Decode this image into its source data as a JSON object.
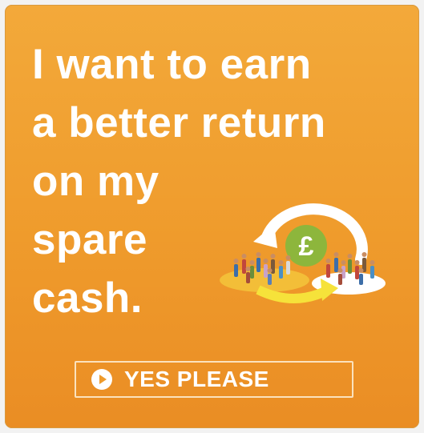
{
  "ad": {
    "headline_lines": [
      "I want to earn",
      "a better return",
      "on my",
      "spare",
      "cash."
    ],
    "currency_symbol": "£",
    "cta_label": "YES PLEASE",
    "cta_icon": "play-icon",
    "illustration_icon": "money-cycle-people-icon",
    "colors": {
      "background": "#ef9b2c",
      "text": "#ffffff",
      "coin": "#8db63c",
      "arrow": "#f6e23a"
    }
  }
}
